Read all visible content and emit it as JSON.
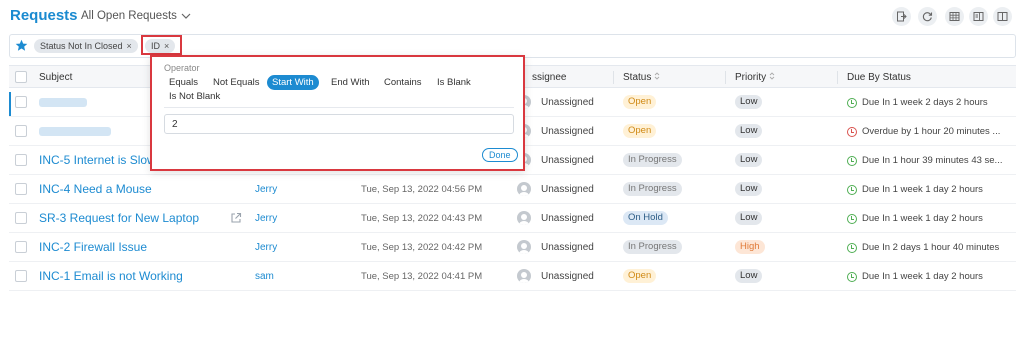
{
  "header": {
    "title": "Requests",
    "view_label": "All Open Requests"
  },
  "toolbar": {
    "icons": [
      "export-icon",
      "refresh-icon",
      "table-view-icon",
      "split-view-icon",
      "column-view-icon"
    ]
  },
  "filters": {
    "chips": [
      {
        "label": "Status Not In Closed",
        "remove": "×"
      },
      {
        "label": "ID",
        "remove": "×"
      }
    ]
  },
  "table": {
    "columns": {
      "subject": "Subject",
      "assignee": "ssignee",
      "status": "Status",
      "priority": "Priority",
      "due": "Due By Status"
    },
    "rows": [
      {
        "subject": "",
        "requester": "",
        "created": "",
        "assignee": "Unassigned",
        "status": "Open",
        "priority": "Low",
        "due": "Due In 1 week 2 days 2 hours",
        "due_color": "#4fae53"
      },
      {
        "subject": "",
        "requester": "",
        "created": "",
        "assignee": "Unassigned",
        "status": "Open",
        "priority": "Low",
        "due": "Overdue by 1 hour 20 minutes ...",
        "due_color": "#d9534f"
      },
      {
        "subject": "INC-5 Internet is Slow",
        "requester": "",
        "created": "",
        "assignee": "Unassigned",
        "status": "In Progress",
        "priority": "Low",
        "due": "Due In 1 hour 39 minutes 43 se...",
        "due_color": "#4fae53"
      },
      {
        "subject": "INC-4 Need a Mouse",
        "requester": "Jerry",
        "created": "Tue, Sep 13, 2022 04:56 PM",
        "assignee": "Unassigned",
        "status": "In Progress",
        "priority": "Low",
        "due": "Due In 1 week 1 day 2 hours",
        "due_color": "#4fae53"
      },
      {
        "subject": "SR-3 Request for New Laptop",
        "requester": "Jerry",
        "created": "Tue, Sep 13, 2022 04:43 PM",
        "assignee": "Unassigned",
        "status": "On Hold",
        "priority": "Low",
        "due": "Due In 1 week 1 day 2 hours",
        "due_color": "#4fae53"
      },
      {
        "subject": "INC-2 Firewall Issue",
        "requester": "Jerry",
        "created": "Tue, Sep 13, 2022 04:42 PM",
        "assignee": "Unassigned",
        "status": "In Progress",
        "priority": "High",
        "due": "Due In 2 days 1 hour 40 minutes",
        "due_color": "#4fae53"
      },
      {
        "subject": "INC-1 Email is not Working",
        "requester": "sam",
        "created": "Tue, Sep 13, 2022 04:41 PM",
        "assignee": "Unassigned",
        "status": "Open",
        "priority": "Low",
        "due": "Due In 1 week 1 day 2 hours",
        "due_color": "#4fae53"
      }
    ]
  },
  "filter_popup": {
    "operator_label": "Operator",
    "operators": [
      "Equals",
      "Not Equals",
      "Start With",
      "End With",
      "Contains",
      "Is Blank",
      "Is Not Blank"
    ],
    "selected": "Start With",
    "value": "2",
    "done_label": "Done"
  },
  "colors": {
    "accent": "#1d8bd1",
    "open": "#fff1d6",
    "in_progress": "#e3e7ec",
    "on_hold": "#dce8f5",
    "high": "#fde6d6",
    "low": "#e3e7ec",
    "highlight_border": "#d9383f"
  }
}
